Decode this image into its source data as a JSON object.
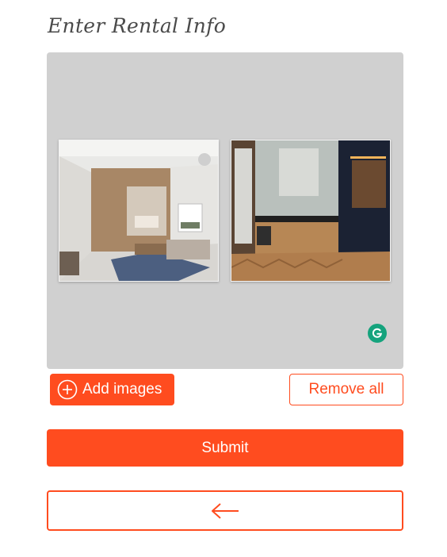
{
  "form": {
    "title": "Enter Rental Info"
  },
  "gallery": {
    "images": [
      {
        "alt": "Studio apartment with wooden bed alcove"
      },
      {
        "alt": "Kitchen with herringbone wood floor"
      }
    ]
  },
  "actions": {
    "add_images_label": "Add images",
    "remove_all_label": "Remove all",
    "submit_label": "Submit"
  },
  "icons": {
    "add": "plus-circle-icon",
    "back": "arrow-left-icon",
    "grammarly": "grammarly-icon"
  },
  "colors": {
    "accent": "#ff4c1f",
    "panel": "#d0d0d0",
    "title": "#4a4a4a",
    "grammarly": "#15a37d"
  }
}
